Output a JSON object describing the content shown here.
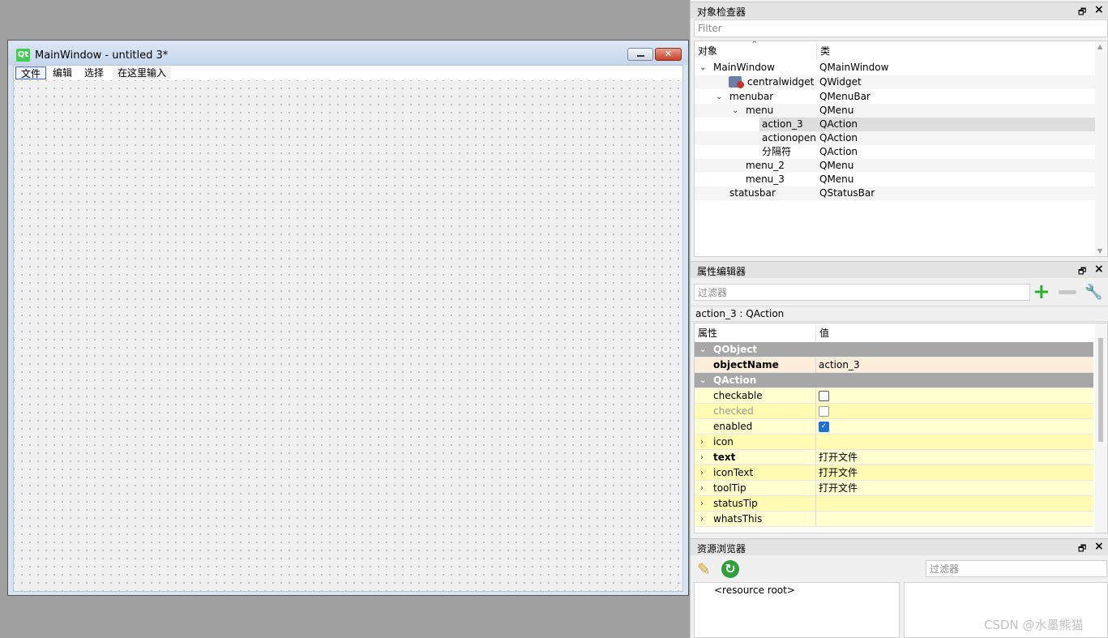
{
  "form": {
    "title": "MainWindow - untitled 3*",
    "logo": "Qt",
    "menus": [
      "文件",
      "编辑",
      "选择",
      "在这里输入"
    ]
  },
  "object_inspector": {
    "title": "对象检查器",
    "filter_placeholder": "Filter",
    "col_object": "对象",
    "col_class": "类",
    "rows": [
      {
        "name": "MainWindow",
        "cls": "QMainWindow"
      },
      {
        "name": "centralwidget",
        "cls": "QWidget"
      },
      {
        "name": "menubar",
        "cls": "QMenuBar"
      },
      {
        "name": "menu",
        "cls": "QMenu"
      },
      {
        "name": "action_3",
        "cls": "QAction"
      },
      {
        "name": "actionopen",
        "cls": "QAction"
      },
      {
        "name": "分隔符",
        "cls": "QAction"
      },
      {
        "name": "menu_2",
        "cls": "QMenu"
      },
      {
        "name": "menu_3",
        "cls": "QMenu"
      },
      {
        "name": "statusbar",
        "cls": "QStatusBar"
      }
    ]
  },
  "property_editor": {
    "title": "属性编辑器",
    "filter_placeholder": "过滤器",
    "object_label": "action_3 : QAction",
    "col_property": "属性",
    "col_value": "值",
    "rows": [
      {
        "key": "QObject",
        "value": ""
      },
      {
        "key": "objectName",
        "value": "action_3"
      },
      {
        "key": "QAction",
        "value": ""
      },
      {
        "key": "checkable",
        "value": ""
      },
      {
        "key": "checked",
        "value": ""
      },
      {
        "key": "enabled",
        "value": ""
      },
      {
        "key": "icon",
        "value": ""
      },
      {
        "key": "text",
        "value": "打开文件"
      },
      {
        "key": "iconText",
        "value": "打开文件"
      },
      {
        "key": "toolTip",
        "value": "打开文件"
      },
      {
        "key": "statusTip",
        "value": ""
      },
      {
        "key": "whatsThis",
        "value": ""
      }
    ],
    "checkable": false,
    "checked": false,
    "enabled": true
  },
  "resource_browser": {
    "title": "资源浏览器",
    "filter_placeholder": "过滤器",
    "root_label": "<resource root>"
  },
  "watermark": "CSDN @水墨熊猫",
  "colors": {
    "group_header": "#a7a7a7",
    "property_yellow": "#ffffcf",
    "selection": "#dddddd",
    "accent_check": "#1e6fd9"
  }
}
